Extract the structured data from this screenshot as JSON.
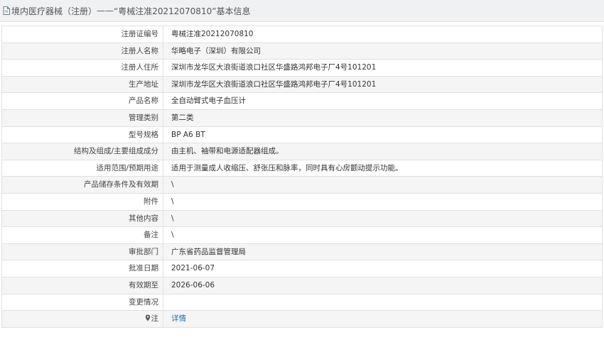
{
  "header": {
    "title": "境内医疗器械（注册）",
    "separator": " —— ",
    "subject": "“粤械注准20212070810”",
    "suffix": " 基本信息",
    "icon": "document-icon"
  },
  "rows": [
    {
      "label": "注册证编号",
      "value": "粤械注准20212070810"
    },
    {
      "label": "注册人名称",
      "value": "华略电子（深圳）有限公司"
    },
    {
      "label": "注册人住所",
      "value": "深圳市龙华区大浪街道浪口社区华盛路鸿邦电子厂4号101201"
    },
    {
      "label": "生产地址",
      "value": "深圳市龙华区大浪街道浪口社区华盛路鸿邦电子厂4号101201"
    },
    {
      "label": "产品名称",
      "value": "全自动臂式电子血压计"
    },
    {
      "label": "管理类别",
      "value": "第二类"
    },
    {
      "label": "型号规格",
      "value": "BP A6 BT"
    },
    {
      "label": "结构及组成/主要组成成分",
      "value": "由主机、袖带和电源适配器组成。"
    },
    {
      "label": "适用范围/预期用途",
      "value": "适用于测量成人收缩压、舒张压和脉率，同时具有心房颤动提示功能。"
    },
    {
      "label": "产品储存条件及有效期",
      "value": "\\"
    },
    {
      "label": "附件",
      "value": "\\"
    },
    {
      "label": "其他内容",
      "value": "\\"
    },
    {
      "label": "备注",
      "value": "\\"
    },
    {
      "label": "审批部门",
      "value": "广东省药品监督管理局"
    },
    {
      "label": "批准日期",
      "value": "2021-06-07"
    },
    {
      "label": "有效期至",
      "value": "2026-06-06"
    },
    {
      "label": "变更情况",
      "value": ""
    }
  ],
  "note_row": {
    "label": "注",
    "link": "详情",
    "icon": "location-pin-icon"
  },
  "colors": {
    "link": "#2b6cb0",
    "header_bg": "#f0f1f3",
    "border": "#e1e1e1"
  }
}
